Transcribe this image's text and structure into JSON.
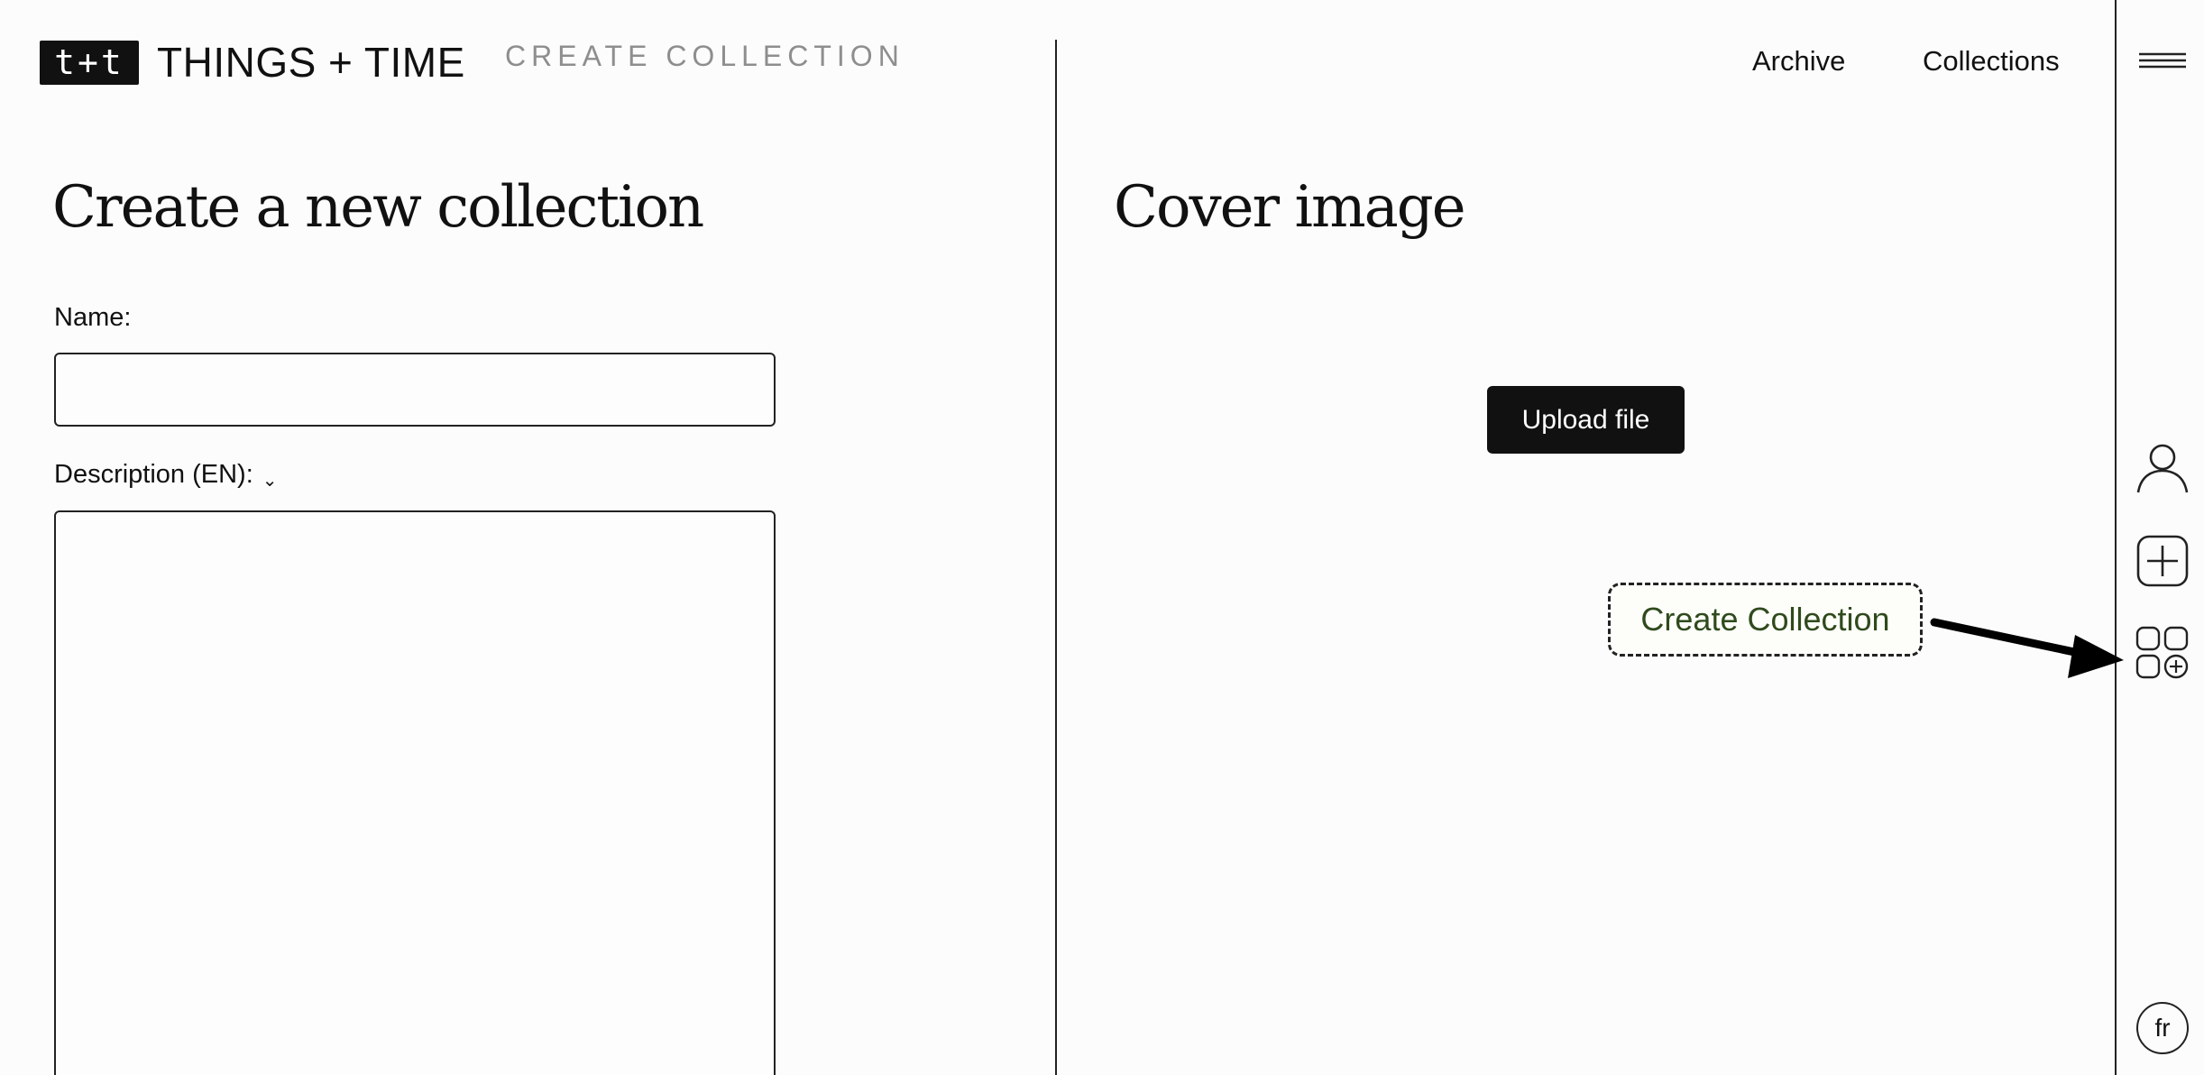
{
  "header": {
    "logo_text": "t+t",
    "brand": "THINGS + TIME",
    "page_subtitle": "CREATE COLLECTION",
    "nav": {
      "archive": "Archive",
      "collections": "Collections"
    }
  },
  "form": {
    "title": "Create a new collection",
    "name_label": "Name:",
    "name_value": "",
    "description_label": "Description (EN):",
    "description_value": ""
  },
  "cover": {
    "title": "Cover image",
    "upload_label": "Upload file"
  },
  "annotation": {
    "callout_text": "Create Collection"
  },
  "sidebar": {
    "icons": [
      "menu-icon",
      "user-icon",
      "plus-square-icon",
      "collection-add-icon"
    ],
    "language": "fr"
  }
}
